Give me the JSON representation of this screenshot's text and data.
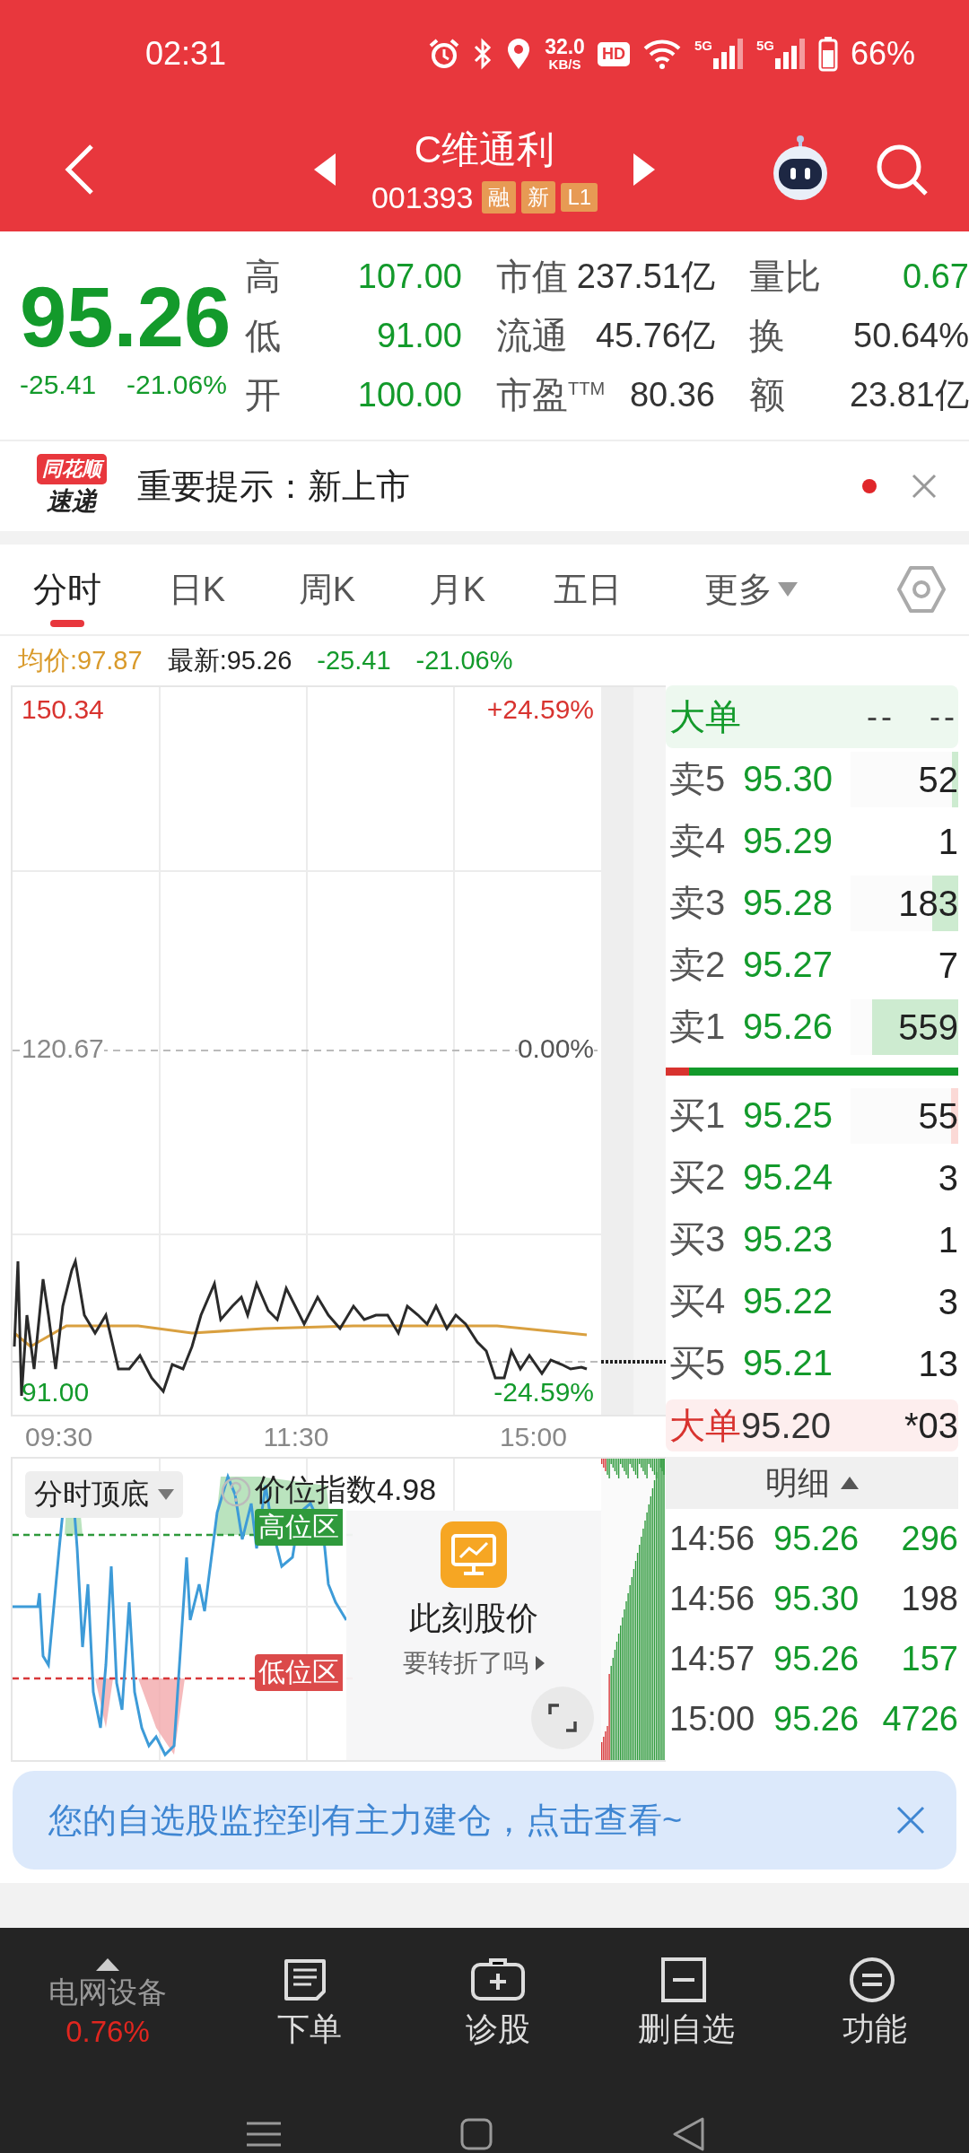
{
  "status_bar": {
    "time": "02:31",
    "net_speed": "32.0",
    "net_speed_unit": "KB/S",
    "hd": "HD",
    "signal_labels": [
      "5G",
      "5G"
    ],
    "battery": "66%"
  },
  "header": {
    "title": "C维通利",
    "code": "001393",
    "tags": [
      "融",
      "新",
      "L1"
    ]
  },
  "quote": {
    "price": "95.26",
    "change": "-25.41",
    "change_pct": "-21.06%",
    "stats": [
      {
        "label": "高",
        "value": "107.00",
        "color": "#139a2b"
      },
      {
        "label": "市值",
        "value": "237.51亿",
        "color": "#333333"
      },
      {
        "label": "量比",
        "value": "0.67",
        "color": "#139a2b"
      },
      {
        "label": "低",
        "value": "91.00",
        "color": "#139a2b"
      },
      {
        "label": "流通",
        "value": "45.76亿",
        "color": "#333333"
      },
      {
        "label": "换",
        "value": "50.64%",
        "color": "#333333"
      },
      {
        "label": "开",
        "value": "100.00",
        "color": "#139a2b"
      },
      {
        "label": "市盈$^{TTM}$",
        "value": "80.36",
        "color": "#333333"
      },
      {
        "label": "额",
        "value": "23.81亿",
        "color": "#333333"
      }
    ]
  },
  "notice": {
    "logo_top": "同花顺",
    "logo_bottom": "速递",
    "text": "重要提示：新上市",
    "unread": true
  },
  "tabs": [
    {
      "label": "分时",
      "kind": "tab",
      "selected": true
    },
    {
      "label": "日K",
      "kind": "tab",
      "selected": false
    },
    {
      "label": "周K",
      "kind": "tab",
      "selected": false
    },
    {
      "label": "月K",
      "kind": "tab",
      "selected": false
    },
    {
      "label": "五日",
      "kind": "tab",
      "selected": false
    },
    {
      "label": "更多",
      "kind": "dropdown",
      "selected": false
    }
  ],
  "info_line": {
    "avg": "均价:97.87",
    "latest": "最新:95.26",
    "change": "-25.41",
    "change_pct": "-21.06%"
  },
  "chart": {
    "top_price": "150.34",
    "top_pct": "+24.59%",
    "mid_price": "120.67",
    "mid_pct": "0.00%",
    "bottom_price": "91.00",
    "bottom_pct": "-24.59%",
    "times": [
      "09:30",
      "11:30",
      "15:00"
    ]
  },
  "indicator": {
    "selector": "分时顶底",
    "index_label": "价位指数4.98",
    "high_zone": "高位区",
    "low_zone": "低位区",
    "popup_title": "此刻股价",
    "popup_subtitle": "要转折了吗"
  },
  "order_book": {
    "big_order_header": {
      "label": "大单",
      "col_2": "--",
      "col_3": "--"
    },
    "asks": [
      {
        "label": "卖5",
        "price": "95.30",
        "volume": "52",
        "level": 0.06
      },
      {
        "label": "卖4",
        "price": "95.29",
        "volume": "1"
      },
      {
        "label": "卖3",
        "price": "95.28",
        "volume": "183",
        "level": 0.24
      },
      {
        "label": "卖2",
        "price": "95.27",
        "volume": "7"
      },
      {
        "label": "卖1",
        "price": "95.26",
        "volume": "559",
        "level": 0.8
      }
    ],
    "balance": {
      "level": 0.08
    },
    "bids": [
      {
        "label": "买1",
        "price": "95.25",
        "volume": "55",
        "level": 0.07
      },
      {
        "label": "买2",
        "price": "95.24",
        "volume": "3"
      },
      {
        "label": "买3",
        "price": "95.23",
        "volume": "1"
      },
      {
        "label": "买4",
        "price": "95.22",
        "volume": "3"
      },
      {
        "label": "买5",
        "price": "95.21",
        "volume": "13"
      }
    ],
    "big_order": {
      "label": "大单",
      "price": "95.20",
      "volume": "*03"
    },
    "detail_label": "明细",
    "trades": [
      {
        "time": "14:56",
        "price": "95.26",
        "volume": "296",
        "color": "#139a2b"
      },
      {
        "time": "14:56",
        "price": "95.30",
        "volume": "198",
        "color": "#333333"
      },
      {
        "time": "14:57",
        "price": "95.26",
        "volume": "157",
        "color": "#139a2b"
      },
      {
        "time": "15:00",
        "price": "95.26",
        "volume": "4726",
        "color": "#139a2b"
      }
    ]
  },
  "banner": {
    "text": "您的自选股监控到有主力建仓，点击查看~"
  },
  "bottom_bar": {
    "sector": {
      "name": "电网设备",
      "change": "0.76%"
    },
    "actions": [
      {
        "label": "下单",
        "kind": "order"
      },
      {
        "label": "诊股",
        "kind": "diagnose"
      },
      {
        "label": "删自选",
        "kind": "remove"
      },
      {
        "label": "功能",
        "kind": "menu"
      }
    ]
  }
}
